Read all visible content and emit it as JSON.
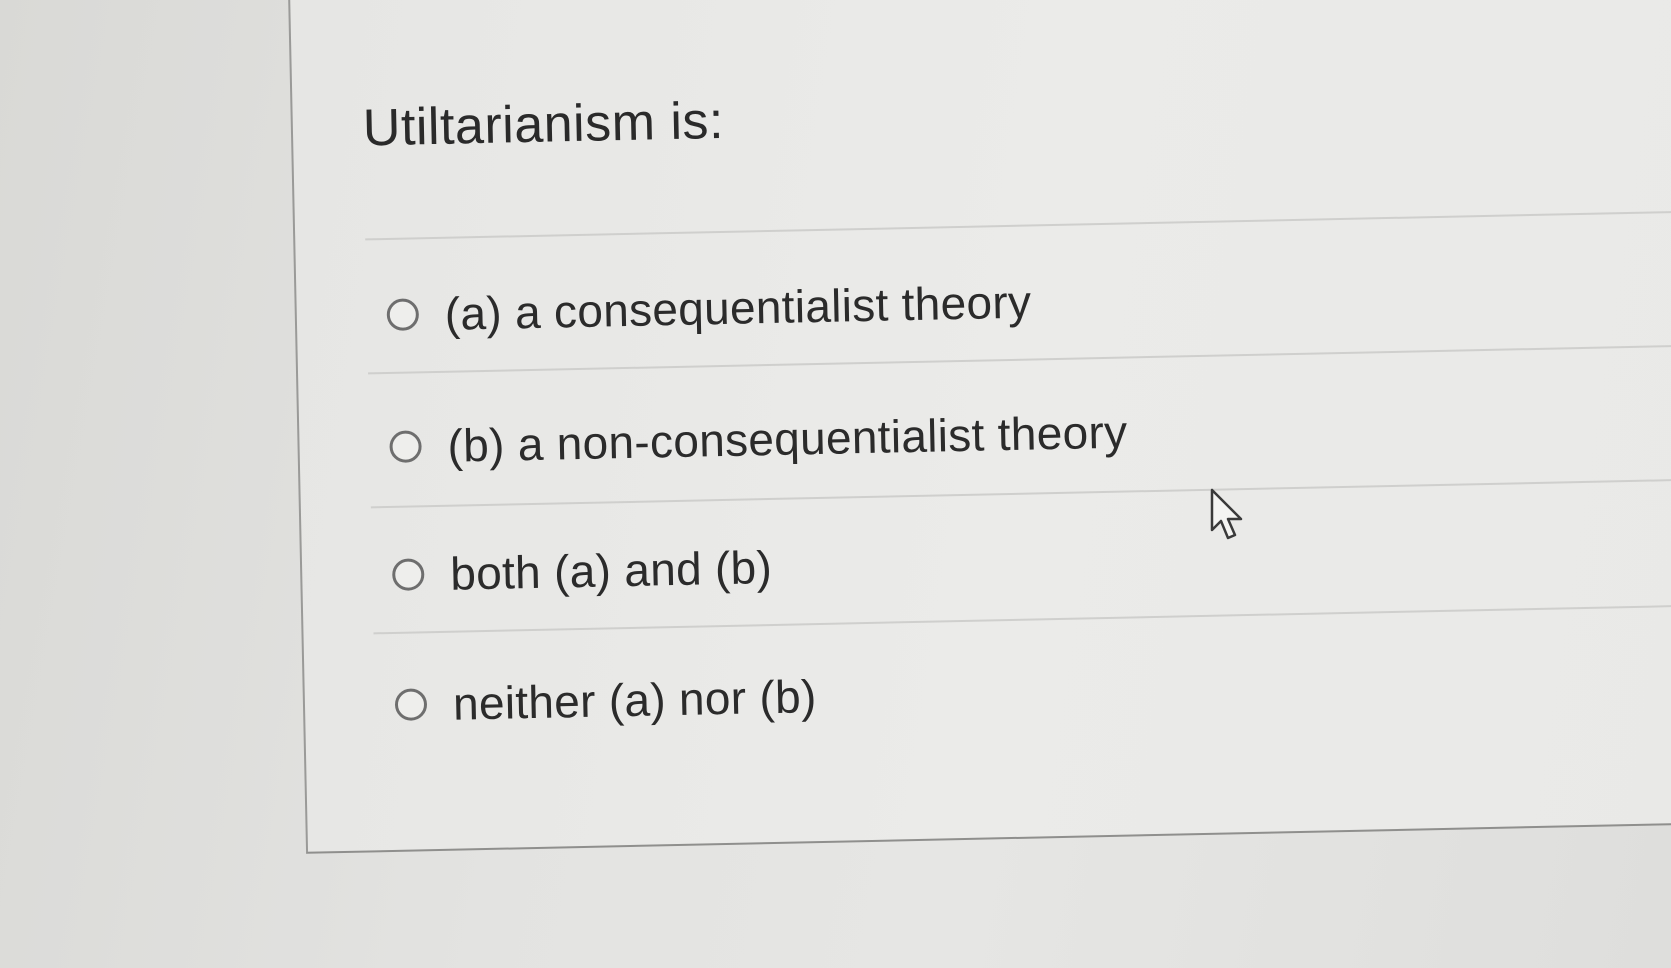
{
  "question": {
    "text": "Utiltarianism is:"
  },
  "answers": [
    {
      "label": "(a) a consequentialist theory",
      "selected": false
    },
    {
      "label": "(b) a non-consequentialist theory",
      "selected": false
    },
    {
      "label": "both (a) and (b)",
      "selected": false
    },
    {
      "label": "neither (a) nor (b)",
      "selected": false
    }
  ],
  "icons": {
    "radio": "radio-button-empty-icon",
    "cursor": "mouse-pointer-icon"
  },
  "colors": {
    "background": "#dcdcda",
    "card": "#e9e9e7",
    "text": "#2a2a2a",
    "radio_border": "#6e6e6e",
    "divider": "#cfcfcd"
  }
}
